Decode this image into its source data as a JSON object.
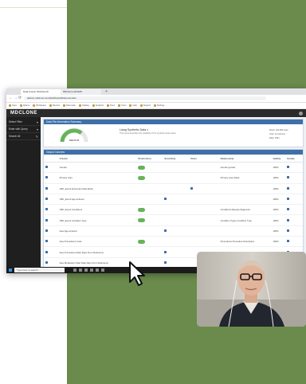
{
  "window": {
    "tabs": [
      "Data Fusion Workbench",
      "MDClone ADAMS"
    ],
    "url": "adams.mdclone.com/dashboard/data-scenario"
  },
  "bookmarks": [
    "Apps",
    "Adams",
    "Workspace",
    "Reports",
    "Data Lake",
    "Catalog",
    "Analytics",
    "Docs",
    "Team",
    "Help",
    "Support",
    "Settings"
  ],
  "app": {
    "logo": "MDCLONE"
  },
  "sidebar": {
    "items": [
      {
        "label": "Select Filter",
        "icon": "▾"
      },
      {
        "label": "Enter with Query",
        "icon": "▾"
      },
      {
        "label": "Search All",
        "icon": "✎"
      }
    ]
  },
  "summary": {
    "panel_title": "Data File Information Summary",
    "gauge_label": "MEDIUM",
    "title": "Liang Synthetic Data v",
    "subtitle": "This panel describes the reliability of the synthetic data output",
    "kv": [
      "Rows: 100,000 rows",
      "Cols: 12 columns",
      "Date: 2021"
    ]
  },
  "table": {
    "panel_title": "Output Columns",
    "headers": [
      "",
      "Column",
      "Distinctness",
      "Sensitivity",
      "Order",
      "Relationship",
      "Validity",
      "Include"
    ],
    "rows": [
      {
        "name": "Gender",
        "pill": true,
        "dot_col": null,
        "rel": "Gender gender",
        "pct": "100%"
      },
      {
        "name": "Primary Care",
        "pill": true,
        "dot_col": null,
        "rel": "Primary Care Rank",
        "pct": "100%"
      },
      {
        "name": "CBC_Event Encounter Date Rank",
        "pill": false,
        "dot_col": 4,
        "rel": "",
        "pct": "100%"
      },
      {
        "name": "CBC_Event Age at Event",
        "pill": false,
        "dot_col": 3,
        "rel": "",
        "pct": "100%"
      },
      {
        "name": "CBC_Event Conditions",
        "pill": true,
        "dot_col": null,
        "rel": "Conditions Disease Diagnosis",
        "pct": "100%"
      },
      {
        "name": "CBC_Event Condition Type",
        "pill": true,
        "dot_col": null,
        "rel": "Condition Types Condition Type",
        "pct": "100%"
      },
      {
        "name": "Aloe Age at Event",
        "pill": false,
        "dot_col": 3,
        "rel": "",
        "pct": "100%"
      },
      {
        "name": "Aloe Procedures Code",
        "pill": true,
        "dot_col": null,
        "rel": "Procedures Procedure Description",
        "pct": "100%"
      },
      {
        "name": "Aloe Procedures Date Days From Reference",
        "pill": false,
        "dot_col": 3,
        "rel": "",
        "pct": "100%"
      },
      {
        "name": "Aloe Medication Start Date Days From Reference",
        "pill": false,
        "dot_col": 3,
        "rel": "",
        "pct": "100%"
      },
      {
        "name": "Aloe Medication End Date Days From Reference",
        "pill": false,
        "dot_col": 3,
        "rel": "",
        "pct": "100%"
      }
    ]
  },
  "taskbar": {
    "search_placeholder": "Type here to search"
  },
  "colors": {
    "background_green": "#6a8b4c",
    "app_header": "#2b2b2b",
    "panel_blue": "#3e6fa8",
    "pill_green": "#67b35a"
  }
}
